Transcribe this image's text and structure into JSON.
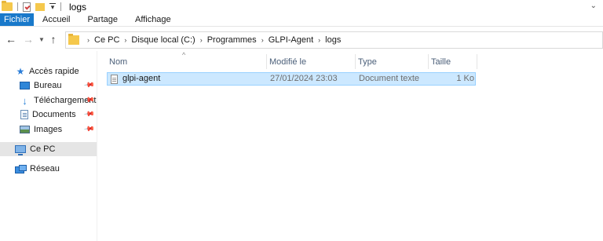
{
  "window": {
    "title": "logs"
  },
  "ribbon": {
    "tabs": [
      "Fichier",
      "Accueil",
      "Partage",
      "Affichage"
    ]
  },
  "address": {
    "breadcrumbs": [
      "Ce PC",
      "Disque local (C:)",
      "Programmes",
      "GLPI-Agent",
      "logs"
    ]
  },
  "sidebar": {
    "quick_access": "Accès rapide",
    "items": [
      "Bureau",
      "Téléchargements",
      "Documents",
      "Images"
    ],
    "this_pc": "Ce PC",
    "network": "Réseau"
  },
  "columns": {
    "name": "Nom",
    "modified": "Modifié le",
    "type": "Type",
    "size": "Taille"
  },
  "files": [
    {
      "name": "glpi-agent",
      "modified": "27/01/2024 23:03",
      "type": "Document texte",
      "size": "1 Ko"
    }
  ],
  "colors": {
    "accent": "#1979ca",
    "selection": "#cce8ff",
    "selection_border": "#99d1ff"
  }
}
